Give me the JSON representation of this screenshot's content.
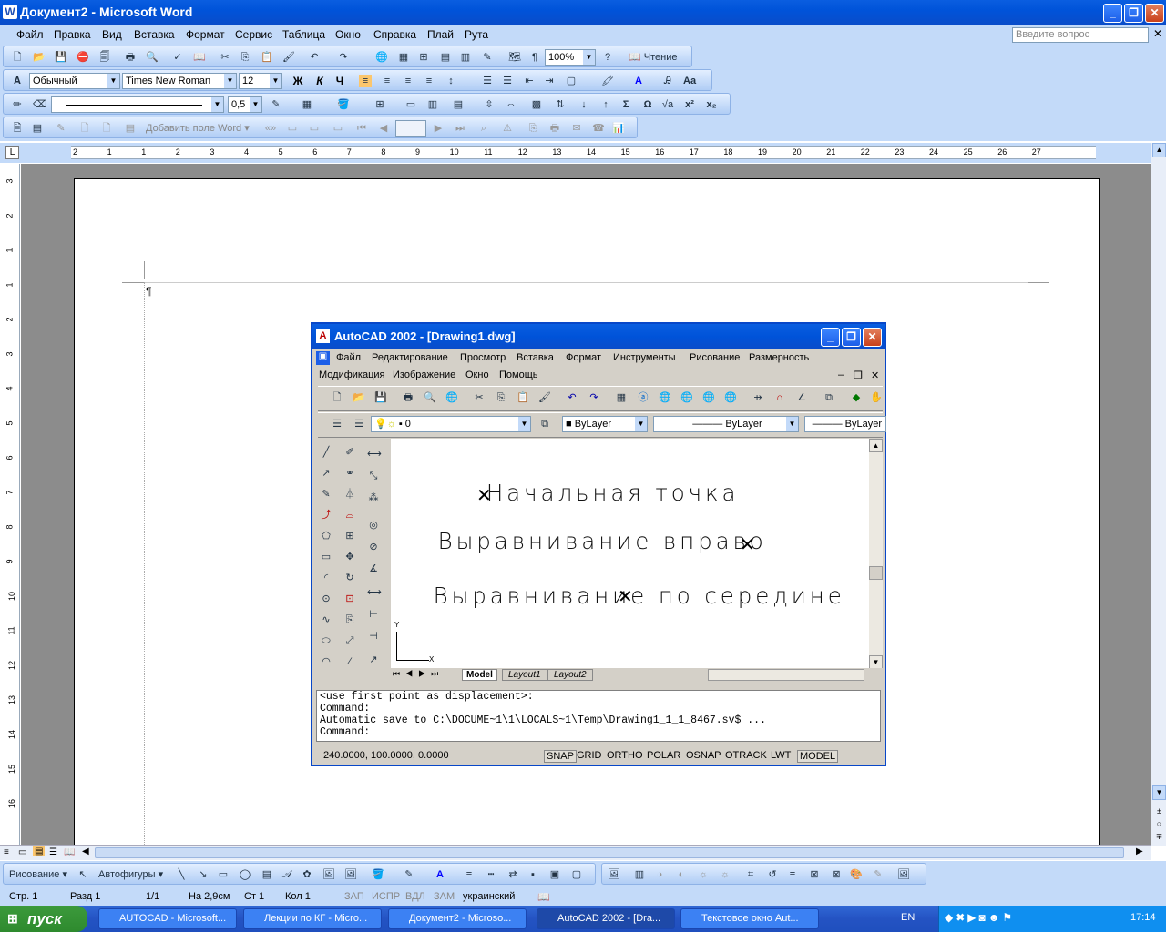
{
  "word": {
    "title": "Документ2 - Microsoft Word",
    "menu": [
      "Файл",
      "Правка",
      "Вид",
      "Вставка",
      "Формат",
      "Сервис",
      "Таблица",
      "Окно",
      "Справка",
      "Плай",
      "Рута"
    ],
    "ask_placeholder": "Введите вопрос",
    "toolbar": {
      "zoom": "100%",
      "read_label": "Чтение"
    },
    "formatting": {
      "style": "Обычный",
      "font": "Times New Roman",
      "size": "12"
    },
    "tables": {
      "line_weight": "0,5"
    },
    "mailmerge": {
      "add_field": "Добавить поле Word"
    },
    "ruler_numbers": [
      "2",
      "1",
      "1",
      "2",
      "3",
      "4",
      "5",
      "6",
      "7",
      "8",
      "9",
      "10",
      "11",
      "12",
      "13",
      "14",
      "15",
      "16",
      "17",
      "18",
      "19",
      "20",
      "21",
      "22",
      "23",
      "24",
      "25",
      "26",
      "27"
    ],
    "vruler_numbers": [
      "3",
      "2",
      "1",
      "1",
      "2",
      "3",
      "4",
      "5",
      "6",
      "7",
      "8",
      "9",
      "10",
      "11",
      "12",
      "13",
      "14",
      "15",
      "16"
    ],
    "drawing": {
      "draw_label": "Рисование",
      "autoshapes_label": "Автофигуры"
    },
    "status": {
      "page": "Стр. 1",
      "section": "Разд 1",
      "pages": "1/1",
      "at": "На 2,9см",
      "line": "Ст 1",
      "col": "Кол 1",
      "rec": "ЗАП",
      "trk": "ИСПР",
      "ext": "ВДЛ",
      "ovr": "ЗАМ",
      "lang": "украинский"
    }
  },
  "acad": {
    "title": "AutoCAD 2002 - [Drawing1.dwg]",
    "menu1": [
      "Файл",
      "Редактирование",
      "Просмотр",
      "Вставка",
      "Формат",
      "Инструменты",
      "Рисование",
      "Размерность"
    ],
    "menu2": [
      "Модификация",
      "Изображение",
      "Окно",
      "Помощь"
    ],
    "layer": "0",
    "color": "ByLayer",
    "linetype": "ByLayer",
    "lineweight": "ByLayer",
    "texts": [
      "Начальная точка",
      "Выравнивание вправо",
      "Выравнивание по середине"
    ],
    "tabs": [
      "Model",
      "Layout1",
      "Layout2"
    ],
    "command_lines": [
      "<use first point as displacement>:",
      "Command:",
      "Automatic save to C:\\DOCUME~1\\1\\LOCALS~1\\Temp\\Drawing1_1_1_8467.sv$ ...",
      "Command:"
    ],
    "coords": "240.0000, 100.0000, 0.0000",
    "modes": [
      "SNAP",
      "GRID",
      "ORTHO",
      "POLAR",
      "OSNAP",
      "OTRACK",
      "LWT",
      "MODEL"
    ],
    "ucs": {
      "x": "X",
      "y": "Y"
    }
  },
  "taskbar": {
    "start": "пуск",
    "tasks": [
      "AUTOCAD - Microsoft...",
      "Лекции по КГ - Micro...",
      "Документ2 - Microso...",
      "AutoCAD 2002 - [Dra...",
      "Текстовое окно Aut..."
    ],
    "lang": "EN",
    "clock": "17:14"
  }
}
